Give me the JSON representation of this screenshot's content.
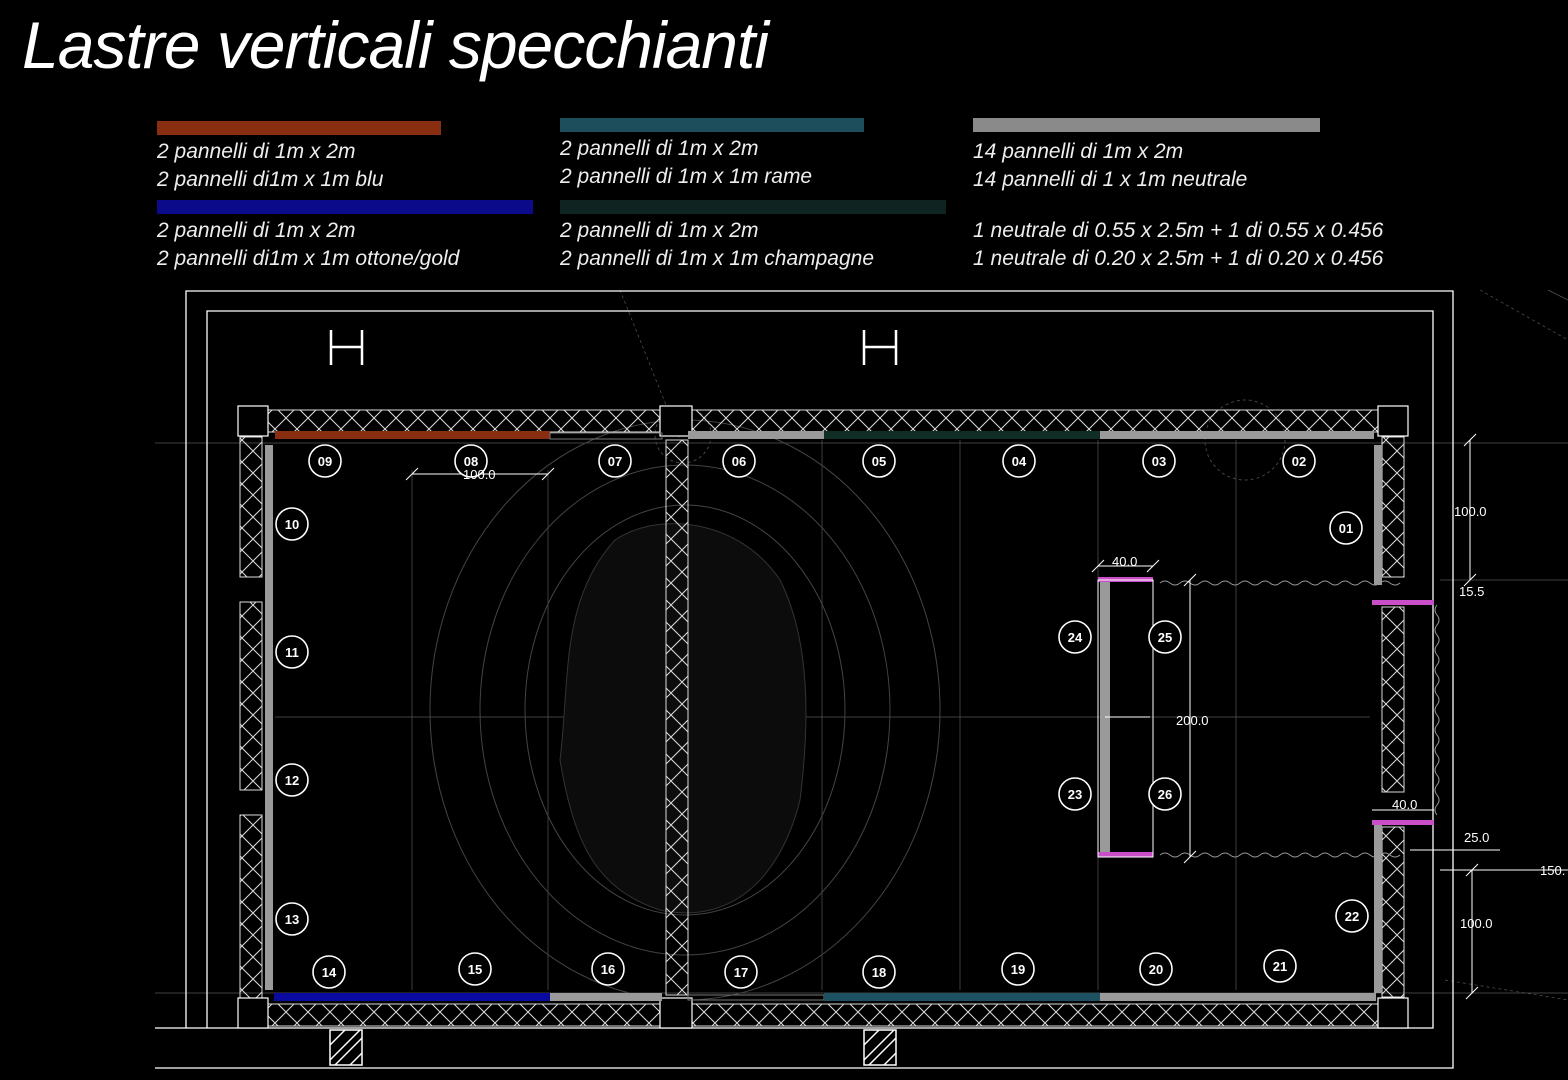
{
  "title": "Lastre verticali specchianti",
  "colors": {
    "copper": "#8a2e12",
    "blue": "#0a0a8a",
    "teal": "#1d4e5c",
    "dark_green": "#0f2420",
    "grey": "#8a8a8a",
    "magenta": "#c94fc9"
  },
  "legend": [
    {
      "color": "copper",
      "lines": [
        "2 pannelli di 1m x 2m",
        "2 pannelli di1m x 1m blu"
      ]
    },
    {
      "color": "blue",
      "lines": [
        "2 pannelli di 1m x 2m",
        "2 pannelli di1m x 1m ottone/gold"
      ]
    },
    {
      "color": "teal",
      "lines": [
        "2 pannelli di 1m x 2m",
        "2 pannelli di 1m x 1m rame"
      ]
    },
    {
      "color": "dark_green",
      "lines": [
        "2 pannelli di 1m x 2m",
        "2 pannelli di 1m x 1m champagne"
      ]
    },
    {
      "color": "grey",
      "lines": [
        "14 pannelli di 1m x 2m",
        "14 pannelli di 1 x 1m neutrale"
      ]
    },
    {
      "color": "none",
      "lines": [
        "1 neutrale di 0.55 x 2.5m + 1 di 0.55 x 0.456",
        "1 neutrale di 0.20 x 2.5m + 1 di 0.20 x 0.456"
      ]
    }
  ],
  "panels": [
    "01",
    "02",
    "03",
    "04",
    "05",
    "06",
    "07",
    "08",
    "09",
    "10",
    "11",
    "12",
    "13",
    "14",
    "15",
    "16",
    "17",
    "18",
    "19",
    "20",
    "21",
    "22",
    "23",
    "24",
    "25",
    "26"
  ],
  "dimensions": {
    "d100_top": "100.0",
    "d100_right_top": "100.0",
    "d15_5": "15.5",
    "d40_inner": "40.0",
    "d200": "200.0",
    "d40_right": "40.0",
    "d25": "25.0",
    "d150": "150.",
    "d100_right_bottom": "100.0"
  }
}
